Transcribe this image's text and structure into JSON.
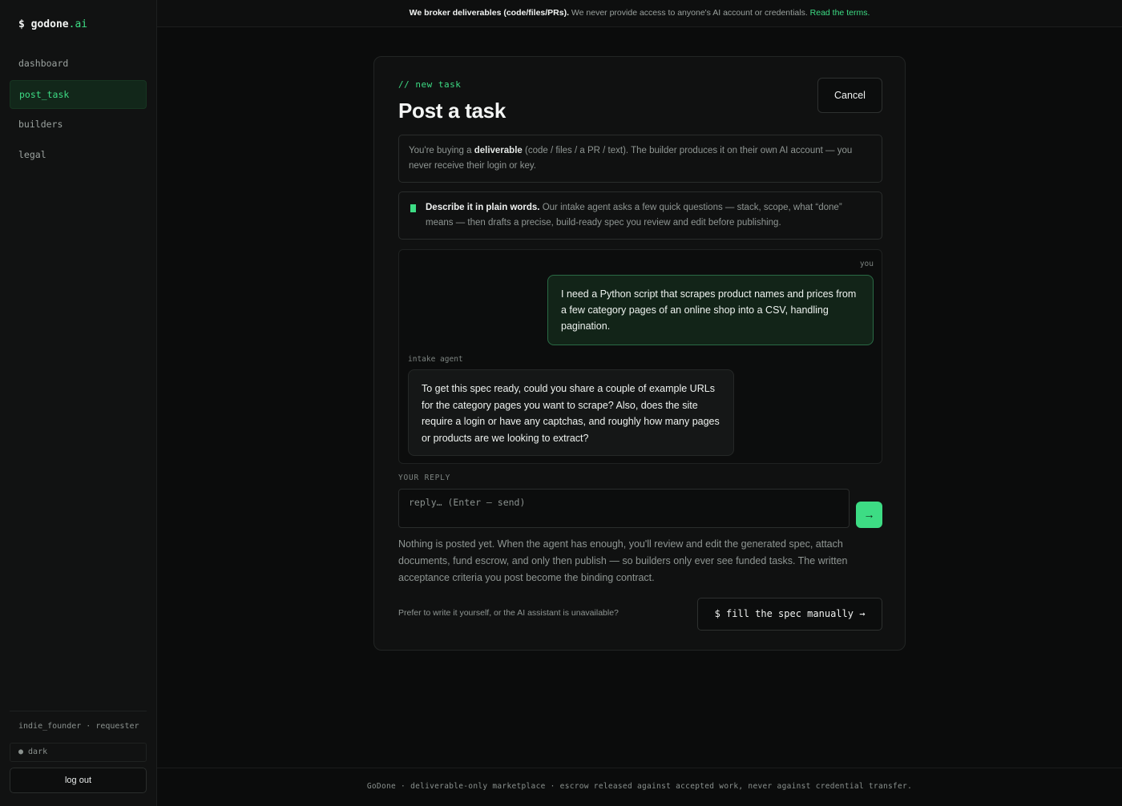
{
  "brand": {
    "prefix": "$ ",
    "name": "godone",
    "tld": ".ai"
  },
  "sidebar": {
    "items": [
      {
        "label": "dashboard",
        "active": false
      },
      {
        "label": "post_task",
        "active": true
      },
      {
        "label": "builders",
        "active": false
      },
      {
        "label": "legal",
        "active": false
      }
    ],
    "user_line": "indie_founder · requester",
    "theme_toggle": "● dark",
    "logout_label": "log out"
  },
  "banner": {
    "bold": "We broker deliverables (code/files/PRs).",
    "text": " We never provide access to anyone's AI account or credentials. ",
    "link": "Read the terms."
  },
  "card": {
    "eyebrow": "// new task",
    "title": "Post a task",
    "cancel_label": "Cancel",
    "info": {
      "pre": "You're buying a ",
      "bold": "deliverable",
      "post": " (code / files / a PR / text). The builder produces it on their own AI account — you never receive their login or key."
    },
    "describe": {
      "bold": "Describe it in plain words.",
      "text": " Our intake agent asks a few quick questions — stack, scope, what “done” means — then drafts a precise, build-ready spec you review and edit before publishing."
    },
    "chat": {
      "you_label": "you",
      "user_message": "I need a Python script that scrapes product names and prices from a few category pages of an online shop into a CSV, handling pagination.",
      "agent_label": "intake agent",
      "agent_message": "To get this spec ready, could you share a couple of example URLs for the category pages you want to scrape? Also, does the site require a login or have any captchas, and roughly how many pages or products are we looking to extract?"
    },
    "reply": {
      "label": "YOUR REPLY",
      "placeholder": "reply… (Enter — send)",
      "send_icon": "→"
    },
    "note": "Nothing is posted yet. When the agent has enough, you'll review and edit the generated spec, attach documents, fund escrow, and only then publish — so builders only ever see funded tasks. The written acceptance criteria you post become the binding contract.",
    "prefer": "Prefer to write it yourself, or the AI assistant is unavailable?",
    "manual_label": "$ fill the spec manually →"
  },
  "footer": "GoDone · deliverable-only marketplace · escrow released against accepted work, never against credential transfer.",
  "colors": {
    "accent": "#3ddc84",
    "background": "#0b0c0c"
  }
}
